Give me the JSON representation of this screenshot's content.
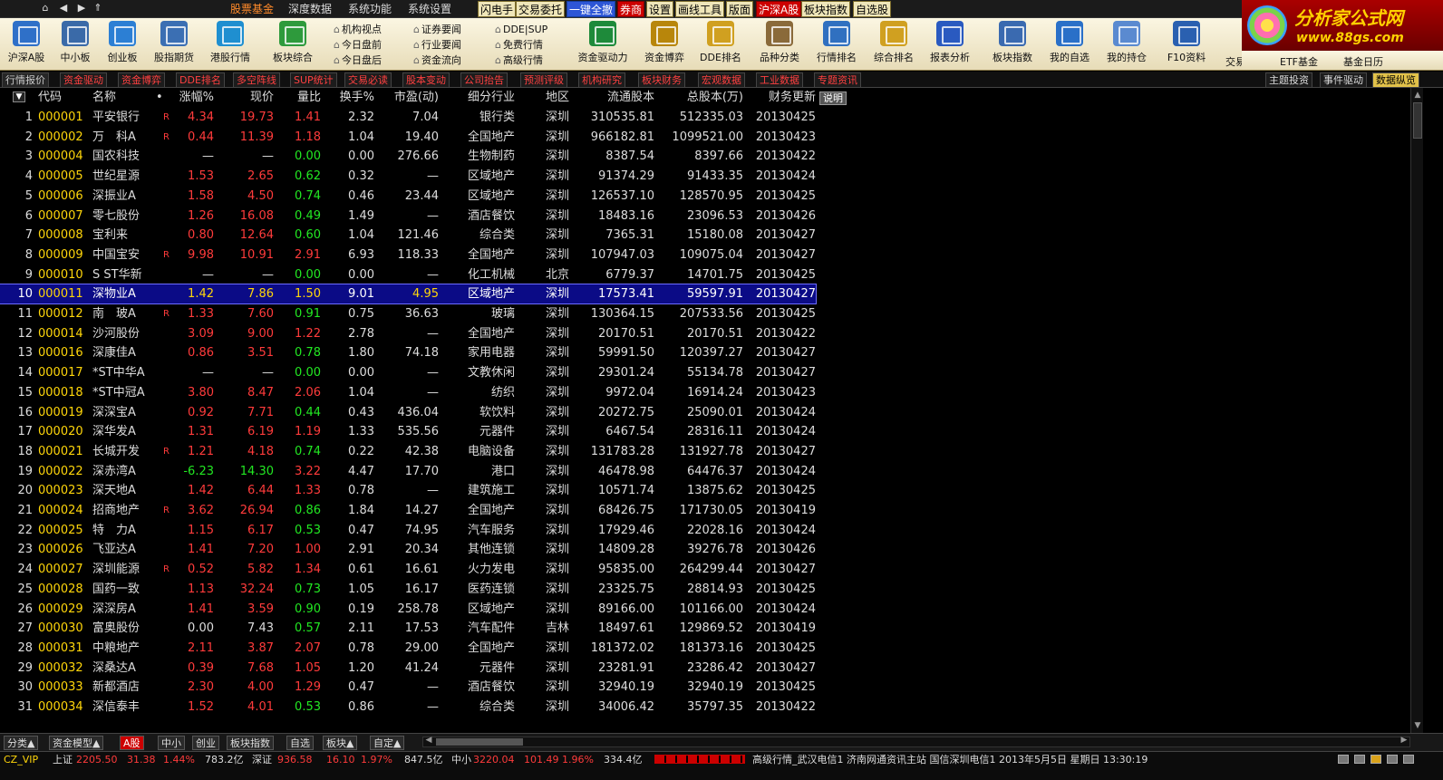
{
  "menubar": {
    "tabs": [
      "股票基金",
      "深度数据",
      "系统功能",
      "系统设置"
    ],
    "active_tab": "股票基金",
    "quick_buttons": [
      {
        "label": "闪电手",
        "style": "light"
      },
      {
        "label": "交易委托",
        "style": "light"
      },
      {
        "label": "一键全撤",
        "style": "blue"
      },
      {
        "label": "券商",
        "style": "red"
      },
      {
        "label": "设置",
        "style": "light"
      },
      {
        "label": "画线工具",
        "style": "light"
      },
      {
        "label": "版面",
        "style": "light"
      },
      {
        "label": "沪深A股",
        "style": "red"
      },
      {
        "label": "板块指数",
        "style": "light"
      },
      {
        "label": "自选股",
        "style": "light"
      }
    ]
  },
  "logo": {
    "line1": "分析家公式网",
    "line2": "www.88gs.com"
  },
  "toolbar": {
    "buttons_left": [
      "沪深A股",
      "中小板",
      "创业板",
      "股指期货",
      "港股行情",
      "板块综合"
    ],
    "stack1": [
      "机构视点",
      "今日盘前",
      "今日盘后"
    ],
    "stack2": [
      "证券要闻",
      "行业要闻",
      "资金流向"
    ],
    "stack3": [
      "DDE|SUP",
      "免费行情",
      "高级行情"
    ],
    "buttons_right": [
      "资金驱动力",
      "资金博弈",
      "DDE排名",
      "品种分类",
      "行情排名",
      "综合排名",
      "报表分析",
      "板块指数",
      "我的自选",
      "我的持仓",
      "F10资料"
    ],
    "row2": [
      "交易所基金",
      "ETF基金",
      "基金日历"
    ]
  },
  "subtabs": {
    "left": [
      "行情报价",
      "资金驱动",
      "资金博弈",
      "DDE排名",
      "多空阵线",
      "SUP统计",
      "交易必读",
      "股本变动",
      "公司抬告",
      "预测评级",
      "机构研究",
      "板块财务",
      "宏观数据",
      "工业数据",
      "专题资讯"
    ],
    "right": [
      "主题投资",
      "事件驱动",
      "数据纵览"
    ]
  },
  "table": {
    "columns": {
      "code": "代码",
      "name": "名称",
      "mark": "•",
      "pct": "涨幅%",
      "price": "现价",
      "vr": "量比",
      "tr": "换手%",
      "pe": "市盈(动)",
      "ind": "细分行业",
      "reg": "地区",
      "flt": "流通股本",
      "tot": "总股本(万)",
      "upd": "财务更新"
    },
    "desc_button": "说明",
    "sort_icon": "▼",
    "selected_index": 10,
    "rows": [
      {
        "i": "1",
        "code": "000001",
        "name": "平安银行",
        "mark": "R",
        "pct": "4.34",
        "price": "19.73",
        "vr": "1.41",
        "tr": "2.32",
        "pe": "7.04",
        "ind": "银行类",
        "reg": "深圳",
        "flt": "310535.81",
        "tot": "512335.03",
        "upd": "20130425",
        "dir": "up"
      },
      {
        "i": "2",
        "code": "000002",
        "name": "万　科A",
        "mark": "R",
        "pct": "0.44",
        "price": "11.39",
        "vr": "1.18",
        "tr": "1.04",
        "pe": "19.40",
        "ind": "全国地产",
        "reg": "深圳",
        "flt": "966182.81",
        "tot": "1099521.00",
        "upd": "20130423",
        "dir": "up"
      },
      {
        "i": "3",
        "code": "000004",
        "name": "国农科技",
        "mark": "",
        "pct": "—",
        "price": "—",
        "vr": "0.00",
        "tr": "0.00",
        "pe": "276.66",
        "ind": "生物制药",
        "reg": "深圳",
        "flt": "8387.54",
        "tot": "8397.66",
        "upd": "20130422",
        "dir": "eq"
      },
      {
        "i": "4",
        "code": "000005",
        "name": "世纪星源",
        "mark": "",
        "pct": "1.53",
        "price": "2.65",
        "vr": "0.62",
        "tr": "0.32",
        "pe": "—",
        "ind": "区域地产",
        "reg": "深圳",
        "flt": "91374.29",
        "tot": "91433.35",
        "upd": "20130424",
        "dir": "up"
      },
      {
        "i": "5",
        "code": "000006",
        "name": "深振业A",
        "mark": "",
        "pct": "1.58",
        "price": "4.50",
        "vr": "0.74",
        "tr": "0.46",
        "pe": "23.44",
        "ind": "区域地产",
        "reg": "深圳",
        "flt": "126537.10",
        "tot": "128570.95",
        "upd": "20130425",
        "dir": "up"
      },
      {
        "i": "6",
        "code": "000007",
        "name": "零七股份",
        "mark": "",
        "pct": "1.26",
        "price": "16.08",
        "vr": "0.49",
        "tr": "1.49",
        "pe": "—",
        "ind": "酒店餐饮",
        "reg": "深圳",
        "flt": "18483.16",
        "tot": "23096.53",
        "upd": "20130426",
        "dir": "up"
      },
      {
        "i": "7",
        "code": "000008",
        "name": "宝利来",
        "mark": "",
        "pct": "0.80",
        "price": "12.64",
        "vr": "0.60",
        "tr": "1.04",
        "pe": "121.46",
        "ind": "综合类",
        "reg": "深圳",
        "flt": "7365.31",
        "tot": "15180.08",
        "upd": "20130427",
        "dir": "up"
      },
      {
        "i": "8",
        "code": "000009",
        "name": "中国宝安",
        "mark": "R",
        "pct": "9.98",
        "price": "10.91",
        "vr": "2.91",
        "tr": "6.93",
        "pe": "118.33",
        "ind": "全国地产",
        "reg": "深圳",
        "flt": "107947.03",
        "tot": "109075.04",
        "upd": "20130427",
        "dir": "up"
      },
      {
        "i": "9",
        "code": "000010",
        "name": "S ST华新",
        "mark": "",
        "pct": "—",
        "price": "—",
        "vr": "0.00",
        "tr": "0.00",
        "pe": "—",
        "ind": "化工机械",
        "reg": "北京",
        "flt": "6779.37",
        "tot": "14701.75",
        "upd": "20130425",
        "dir": "eq"
      },
      {
        "i": "10",
        "code": "000011",
        "name": "深物业A",
        "mark": "",
        "pct": "1.42",
        "price": "7.86",
        "vr": "1.50",
        "tr": "9.01",
        "pe": "4.95",
        "ind": "区域地产",
        "reg": "深圳",
        "flt": "17573.41",
        "tot": "59597.91",
        "upd": "20130427",
        "dir": "up"
      },
      {
        "i": "11",
        "code": "000012",
        "name": "南　玻A",
        "mark": "R",
        "pct": "1.33",
        "price": "7.60",
        "vr": "0.91",
        "tr": "0.75",
        "pe": "36.63",
        "ind": "玻璃",
        "reg": "深圳",
        "flt": "130364.15",
        "tot": "207533.56",
        "upd": "20130425",
        "dir": "up"
      },
      {
        "i": "12",
        "code": "000014",
        "name": "沙河股份",
        "mark": "",
        "pct": "3.09",
        "price": "9.00",
        "vr": "1.22",
        "tr": "2.78",
        "pe": "—",
        "ind": "全国地产",
        "reg": "深圳",
        "flt": "20170.51",
        "tot": "20170.51",
        "upd": "20130422",
        "dir": "up"
      },
      {
        "i": "13",
        "code": "000016",
        "name": "深康佳A",
        "mark": "",
        "pct": "0.86",
        "price": "3.51",
        "vr": "0.78",
        "tr": "1.80",
        "pe": "74.18",
        "ind": "家用电器",
        "reg": "深圳",
        "flt": "59991.50",
        "tot": "120397.27",
        "upd": "20130427",
        "dir": "up"
      },
      {
        "i": "14",
        "code": "000017",
        "name": "*ST中华A",
        "mark": "",
        "pct": "—",
        "price": "—",
        "vr": "0.00",
        "tr": "0.00",
        "pe": "—",
        "ind": "文教休闲",
        "reg": "深圳",
        "flt": "29301.24",
        "tot": "55134.78",
        "upd": "20130427",
        "dir": "eq"
      },
      {
        "i": "15",
        "code": "000018",
        "name": "*ST中冠A",
        "mark": "",
        "pct": "3.80",
        "price": "8.47",
        "vr": "2.06",
        "tr": "1.04",
        "pe": "—",
        "ind": "纺织",
        "reg": "深圳",
        "flt": "9972.04",
        "tot": "16914.24",
        "upd": "20130423",
        "dir": "up"
      },
      {
        "i": "16",
        "code": "000019",
        "name": "深深宝A",
        "mark": "",
        "pct": "0.92",
        "price": "7.71",
        "vr": "0.44",
        "tr": "0.43",
        "pe": "436.04",
        "ind": "软饮料",
        "reg": "深圳",
        "flt": "20272.75",
        "tot": "25090.01",
        "upd": "20130424",
        "dir": "up"
      },
      {
        "i": "17",
        "code": "000020",
        "name": "深华发A",
        "mark": "",
        "pct": "1.31",
        "price": "6.19",
        "vr": "1.19",
        "tr": "1.33",
        "pe": "535.56",
        "ind": "元器件",
        "reg": "深圳",
        "flt": "6467.54",
        "tot": "28316.11",
        "upd": "20130424",
        "dir": "up"
      },
      {
        "i": "18",
        "code": "000021",
        "name": "长城开发",
        "mark": "R",
        "pct": "1.21",
        "price": "4.18",
        "vr": "0.74",
        "tr": "0.22",
        "pe": "42.38",
        "ind": "电脑设备",
        "reg": "深圳",
        "flt": "131783.28",
        "tot": "131927.78",
        "upd": "20130427",
        "dir": "up"
      },
      {
        "i": "19",
        "code": "000022",
        "name": "深赤湾A",
        "mark": "",
        "pct": "-6.23",
        "price": "14.30",
        "vr": "3.22",
        "tr": "4.47",
        "pe": "17.70",
        "ind": "港口",
        "reg": "深圳",
        "flt": "46478.98",
        "tot": "64476.37",
        "upd": "20130424",
        "dir": "dn"
      },
      {
        "i": "20",
        "code": "000023",
        "name": "深天地A",
        "mark": "",
        "pct": "1.42",
        "price": "6.44",
        "vr": "1.33",
        "tr": "0.78",
        "pe": "—",
        "ind": "建筑施工",
        "reg": "深圳",
        "flt": "10571.74",
        "tot": "13875.62",
        "upd": "20130425",
        "dir": "up"
      },
      {
        "i": "21",
        "code": "000024",
        "name": "招商地产",
        "mark": "R",
        "pct": "3.62",
        "price": "26.94",
        "vr": "0.86",
        "tr": "1.84",
        "pe": "14.27",
        "ind": "全国地产",
        "reg": "深圳",
        "flt": "68426.75",
        "tot": "171730.05",
        "upd": "20130419",
        "dir": "up"
      },
      {
        "i": "22",
        "code": "000025",
        "name": "特　力A",
        "mark": "",
        "pct": "1.15",
        "price": "6.17",
        "vr": "0.53",
        "tr": "0.47",
        "pe": "74.95",
        "ind": "汽车服务",
        "reg": "深圳",
        "flt": "17929.46",
        "tot": "22028.16",
        "upd": "20130424",
        "dir": "up"
      },
      {
        "i": "23",
        "code": "000026",
        "name": "飞亚达A",
        "mark": "",
        "pct": "1.41",
        "price": "7.20",
        "vr": "1.00",
        "tr": "2.91",
        "pe": "20.34",
        "ind": "其他连锁",
        "reg": "深圳",
        "flt": "14809.28",
        "tot": "39276.78",
        "upd": "20130426",
        "dir": "up"
      },
      {
        "i": "24",
        "code": "000027",
        "name": "深圳能源",
        "mark": "R",
        "pct": "0.52",
        "price": "5.82",
        "vr": "1.34",
        "tr": "0.61",
        "pe": "16.61",
        "ind": "火力发电",
        "reg": "深圳",
        "flt": "95835.00",
        "tot": "264299.44",
        "upd": "20130427",
        "dir": "up"
      },
      {
        "i": "25",
        "code": "000028",
        "name": "国药一致",
        "mark": "",
        "pct": "1.13",
        "price": "32.24",
        "vr": "0.73",
        "tr": "1.05",
        "pe": "16.17",
        "ind": "医药连锁",
        "reg": "深圳",
        "flt": "23325.75",
        "tot": "28814.93",
        "upd": "20130425",
        "dir": "up"
      },
      {
        "i": "26",
        "code": "000029",
        "name": "深深房A",
        "mark": "",
        "pct": "1.41",
        "price": "3.59",
        "vr": "0.90",
        "tr": "0.19",
        "pe": "258.78",
        "ind": "区域地产",
        "reg": "深圳",
        "flt": "89166.00",
        "tot": "101166.00",
        "upd": "20130424",
        "dir": "up"
      },
      {
        "i": "27",
        "code": "000030",
        "name": "富奥股份",
        "mark": "",
        "pct": "0.00",
        "price": "7.43",
        "vr": "0.57",
        "tr": "2.11",
        "pe": "17.53",
        "ind": "汽车配件",
        "reg": "吉林",
        "flt": "18497.61",
        "tot": "129869.52",
        "upd": "20130419",
        "dir": "flat"
      },
      {
        "i": "28",
        "code": "000031",
        "name": "中粮地产",
        "mark": "",
        "pct": "2.11",
        "price": "3.87",
        "vr": "2.07",
        "tr": "0.78",
        "pe": "29.00",
        "ind": "全国地产",
        "reg": "深圳",
        "flt": "181372.02",
        "tot": "181373.16",
        "upd": "20130425",
        "dir": "up"
      },
      {
        "i": "29",
        "code": "000032",
        "name": "深桑达A",
        "mark": "",
        "pct": "0.39",
        "price": "7.68",
        "vr": "1.05",
        "tr": "1.20",
        "pe": "41.24",
        "ind": "元器件",
        "reg": "深圳",
        "flt": "23281.91",
        "tot": "23286.42",
        "upd": "20130427",
        "dir": "up"
      },
      {
        "i": "30",
        "code": "000033",
        "name": "新都酒店",
        "mark": "",
        "pct": "2.30",
        "price": "4.00",
        "vr": "1.29",
        "tr": "0.47",
        "pe": "—",
        "ind": "酒店餐饮",
        "reg": "深圳",
        "flt": "32940.19",
        "tot": "32940.19",
        "upd": "20130425",
        "dir": "up"
      },
      {
        "i": "31",
        "code": "000034",
        "name": "深信泰丰",
        "mark": "",
        "pct": "1.52",
        "price": "4.01",
        "vr": "0.53",
        "tr": "0.86",
        "pe": "—",
        "ind": "综合类",
        "reg": "深圳",
        "flt": "34006.42",
        "tot": "35797.35",
        "upd": "20130422",
        "dir": "up"
      }
    ]
  },
  "bottom_tabs": [
    "分类▲",
    "资金模型▲",
    "A股",
    "中小",
    "创业",
    "板块指数",
    "自选",
    "板块▲",
    "自定▲"
  ],
  "bottom_active": "A股",
  "status": {
    "prefix": "CZ_VIP",
    "sh_label": "上证",
    "sh_value": "2205.50",
    "sh_change": "31.38",
    "sh_pct": "1.44%",
    "sh_amount": "783.2亿",
    "sz_label": "深证",
    "sz_value": "936.58",
    "sz_change": "16.10",
    "sz_pct": "1.97%",
    "sz_amount": "847.5亿",
    "zx_label": "中小",
    "zx_value": "3220.04",
    "zx_change": "101.49",
    "zx_pct": "1.96%",
    "zx_amount": "334.4亿",
    "ticker": "高级行情_武汉电信1  济南网通资讯主站  国信深圳电信1  2013年5月5日  星期日  13:30:19"
  },
  "colors": {
    "up": "#ff3b3b",
    "down": "#22e822",
    "code": "#ffd60a",
    "selected": "#0b0b86"
  }
}
